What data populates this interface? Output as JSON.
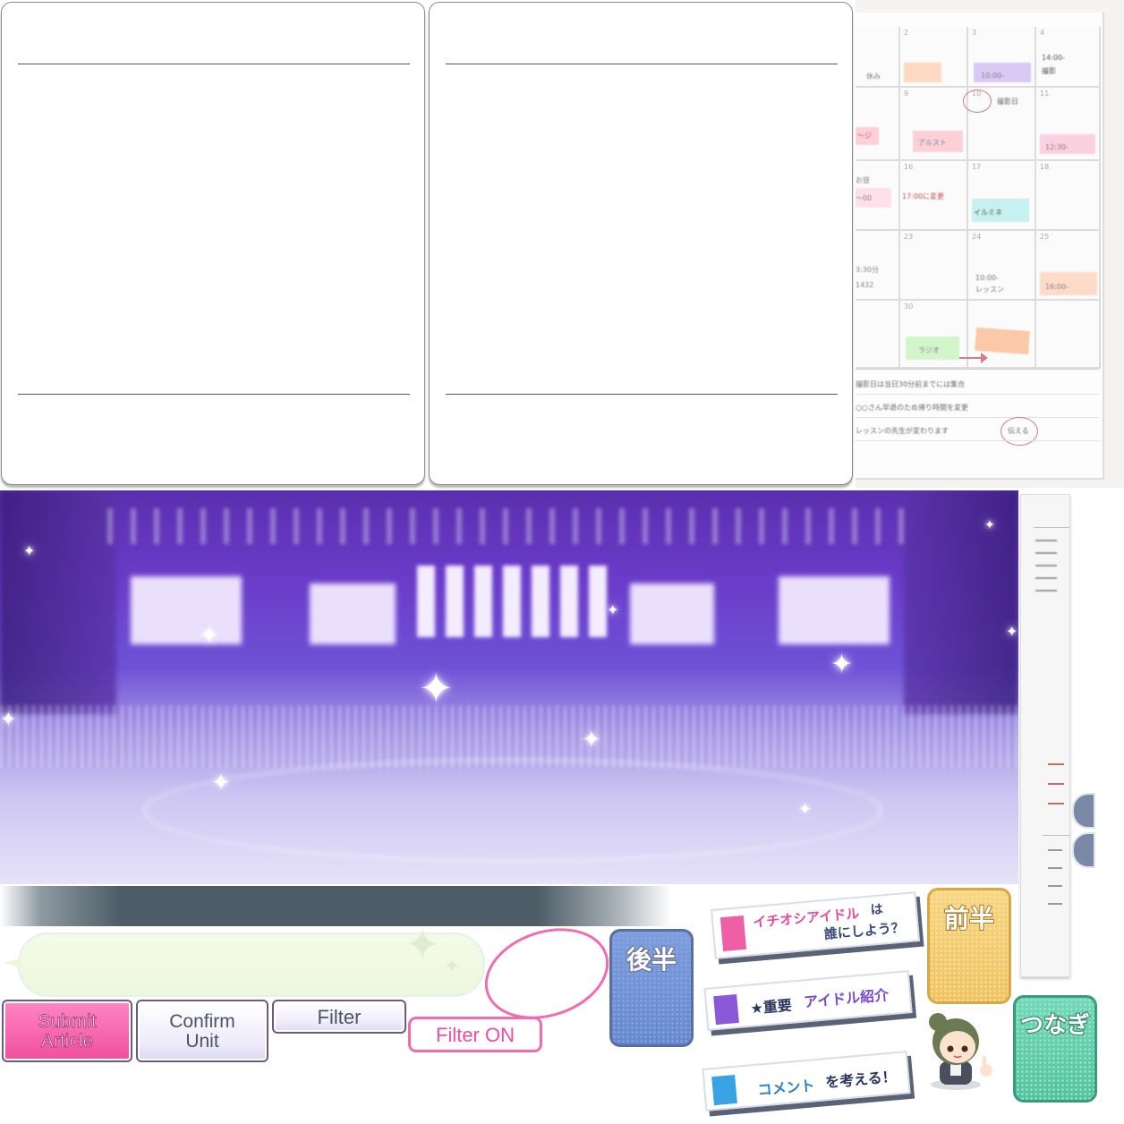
{
  "calendar": {
    "days": [
      "2",
      "3",
      "4",
      "9",
      "10",
      "11",
      "16",
      "17",
      "18",
      "23",
      "24",
      "25",
      "30"
    ],
    "entries": [
      "休み",
      "10:00-",
      "14:00-",
      "撮影",
      "アルスト",
      "撮影日",
      "12:30-",
      "17:00に変更",
      "イルミネ",
      "10:00-",
      "レッスン",
      "16:00-",
      "ラジオ",
      "〜ジ",
      "お昼",
      "〜00",
      "3:30分",
      "1432"
    ],
    "notes": [
      "撮影日は当日30分前までには集合",
      "○○さん早退のため帰り時間を変更",
      "レッスンの先生が変わります",
      "伝える"
    ]
  },
  "buttons": {
    "submit": {
      "line1": "Submit",
      "line2": "Article"
    },
    "confirm": {
      "line1": "Confirm",
      "line2": "Unit"
    },
    "filter": "Filter",
    "filter_on": "Filter ON",
    "kouhan": "後半",
    "zenhan": "前半",
    "tsunagi": "つなぎ"
  },
  "banners": {
    "oshi": {
      "part1": "イチオシアイドル",
      "part2": "は",
      "line2": "誰にしよう？"
    },
    "juyou": {
      "star": "★重要",
      "rest": "アイドル紹介"
    },
    "comment": {
      "part1": "コメント",
      "part2": "を考える！"
    }
  },
  "colors": {
    "pink": "#f04e9e",
    "blue": "#6f93d6",
    "yellow": "#f2c96a",
    "green": "#5cc9a4",
    "purple": "#8b5bd6"
  }
}
